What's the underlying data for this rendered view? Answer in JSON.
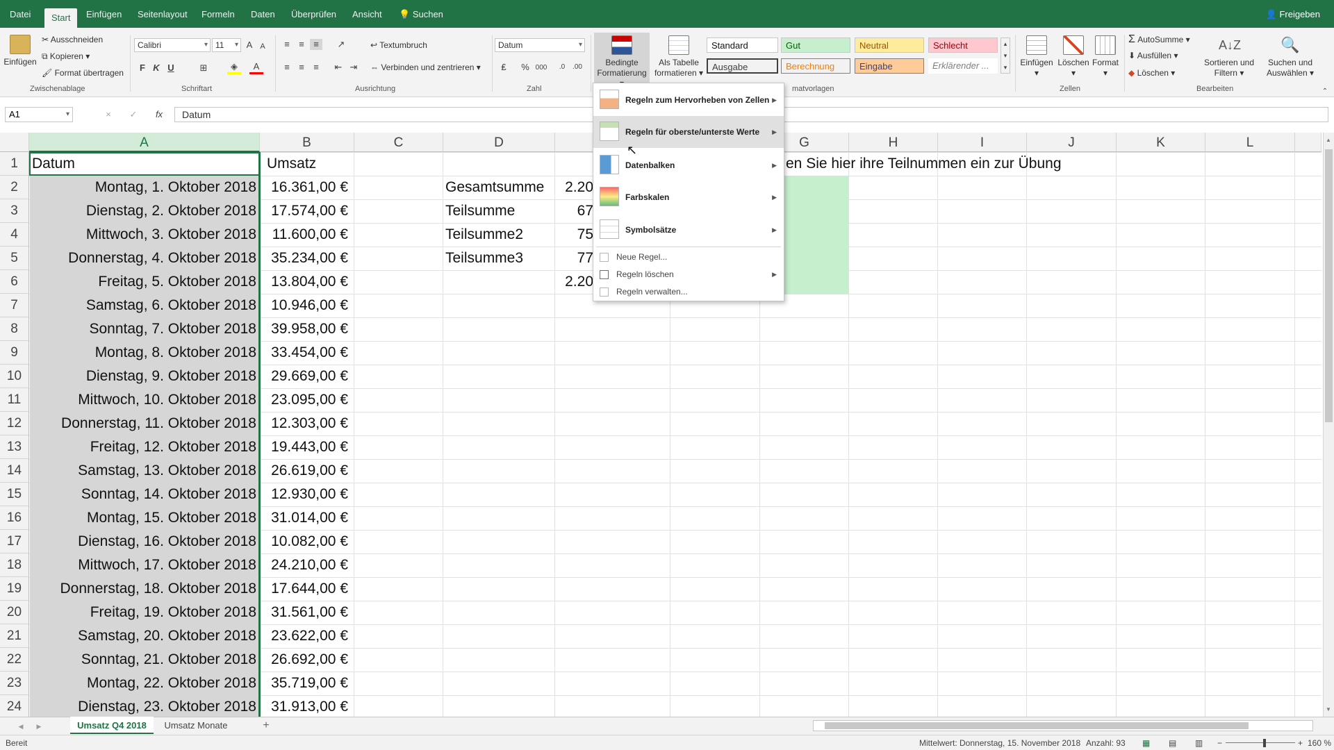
{
  "ribbon_tabs": {
    "file": "Datei",
    "home": "Start",
    "insert": "Einfügen",
    "layout": "Seitenlayout",
    "formulas": "Formeln",
    "data": "Daten",
    "review": "Überprüfen",
    "view": "Ansicht",
    "search": "Suchen"
  },
  "share_label": "Freigeben",
  "clipboard": {
    "paste": "Einfügen",
    "cut": "Ausschneiden",
    "copy": "Kopieren",
    "format_painter": "Format übertragen",
    "group": "Zwischenablage"
  },
  "font": {
    "name": "Calibri",
    "size": "11",
    "bold": "F",
    "italic": "K",
    "underline": "U",
    "group": "Schriftart"
  },
  "alignment": {
    "wrap": "Textumbruch",
    "merge": "Verbinden und zentrieren",
    "group": "Ausrichtung"
  },
  "number": {
    "format": "Datum",
    "percent": "%",
    "thousands": "000",
    "group": "Zahl"
  },
  "styles": {
    "cond_format_line1": "Bedingte",
    "cond_format_line2": "Formatierung",
    "as_table_line1": "Als Tabelle",
    "as_table_line2": "formatieren",
    "standard": "Standard",
    "gut": "Gut",
    "neutral": "Neutral",
    "schlecht": "Schlecht",
    "ausgabe": "Ausgabe",
    "berechnung": "Berechnung",
    "eingabe": "Eingabe",
    "erklaerend": "Erklärender ...",
    "group_partial": "matvorlagen"
  },
  "cells": {
    "insert": "Einfügen",
    "delete": "Löschen",
    "format": "Format",
    "group": "Zellen"
  },
  "editing": {
    "autosum": "AutoSumme",
    "fill": "Ausfüllen",
    "clear": "Löschen",
    "sort_line1": "Sortieren und",
    "sort_line2": "Filtern",
    "find_line1": "Suchen und",
    "find_line2": "Auswählen",
    "group": "Bearbeiten"
  },
  "formula_bar": {
    "name_box": "A1",
    "cancel": "×",
    "enter": "✓",
    "fx": "fx",
    "value": "Datum"
  },
  "columns": [
    "A",
    "B",
    "C",
    "D",
    "E",
    "F",
    "G",
    "H",
    "I",
    "J",
    "K",
    "L"
  ],
  "rows": [
    "1",
    "2",
    "3",
    "4",
    "5",
    "6",
    "7",
    "8",
    "9",
    "10",
    "11",
    "12",
    "13",
    "14",
    "15",
    "16",
    "17",
    "18",
    "19",
    "20",
    "21",
    "22",
    "23",
    "24"
  ],
  "sheet": {
    "a1": "Datum",
    "b1": "Umsatz",
    "g1": "en Sie hier ihre Teilnummen ein zur Übung",
    "dates": [
      "Montag, 1. Oktober 2018",
      "Dienstag, 2. Oktober 2018",
      "Mittwoch, 3. Oktober 2018",
      "Donnerstag, 4. Oktober 2018",
      "Freitag, 5. Oktober 2018",
      "Samstag, 6. Oktober 2018",
      "Sonntag, 7. Oktober 2018",
      "Montag, 8. Oktober 2018",
      "Dienstag, 9. Oktober 2018",
      "Mittwoch, 10. Oktober 2018",
      "Donnerstag, 11. Oktober 2018",
      "Freitag, 12. Oktober 2018",
      "Samstag, 13. Oktober 2018",
      "Sonntag, 14. Oktober 2018",
      "Montag, 15. Oktober 2018",
      "Dienstag, 16. Oktober 2018",
      "Mittwoch, 17. Oktober 2018",
      "Donnerstag, 18. Oktober 2018",
      "Freitag, 19. Oktober 2018",
      "Samstag, 20. Oktober 2018",
      "Sonntag, 21. Oktober 2018",
      "Montag, 22. Oktober 2018",
      "Dienstag, 23. Oktober 2018"
    ],
    "amounts": [
      "16.361,00 €",
      "17.574,00 €",
      "11.600,00 €",
      "35.234,00 €",
      "13.804,00 €",
      "10.946,00 €",
      "39.958,00 €",
      "33.454,00 €",
      "29.669,00 €",
      "23.095,00 €",
      "12.303,00 €",
      "19.443,00 €",
      "26.619,00 €",
      "12.930,00 €",
      "31.014,00 €",
      "10.082,00 €",
      "24.210,00 €",
      "17.644,00 €",
      "31.561,00 €",
      "23.622,00 €",
      "26.692,00 €",
      "35.719,00 €",
      "31.913,00 €"
    ],
    "d_labels": [
      "Gesamtsumme",
      "Teilsumme",
      "Teilsumme2",
      "Teilsumme3"
    ],
    "e_values": [
      "2.20",
      "67",
      "75",
      "77",
      "2.20"
    ]
  },
  "cf_menu": {
    "highlight": "Regeln zum Hervorheben von Zellen",
    "topbottom": "Regeln für oberste/unterste Werte",
    "databars": "Datenbalken",
    "colorscales": "Farbskalen",
    "iconsets": "Symbolsätze",
    "new_rule": "Neue Regel...",
    "clear_rules": "Regeln löschen",
    "manage_rules": "Regeln verwalten..."
  },
  "sheet_tabs": {
    "active": "Umsatz Q4 2018",
    "other": "Umsatz Monate",
    "add": "+"
  },
  "status": {
    "ready": "Bereit",
    "average": "Mittelwert: Donnerstag, 15. November 2018",
    "count": "Anzahl: 93",
    "zoom": "160 %"
  },
  "colors": {
    "accent": "#217346",
    "gut_bg": "#c6efce",
    "gut_fg": "#006100",
    "neutral_bg": "#ffeb9c",
    "neutral_fg": "#9c5700",
    "schlecht_bg": "#ffc7ce",
    "schlecht_fg": "#9c0006",
    "berechnung_fg": "#fa7d00",
    "eingabe_bg": "#ffcc99",
    "selection_green": "#c6efce"
  }
}
